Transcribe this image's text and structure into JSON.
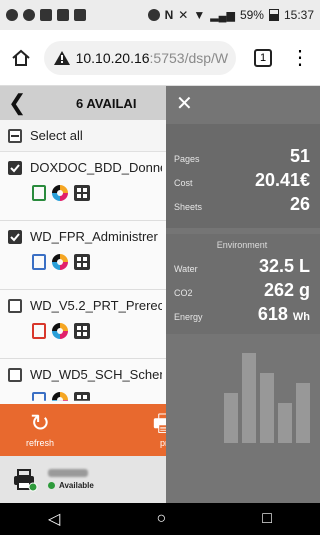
{
  "status": {
    "battery": "59%",
    "time": "15:37"
  },
  "browser": {
    "host": "10.10.20.16",
    "path": ":5753/dsp/W",
    "tab_count": "1"
  },
  "app": {
    "header_title": "6 AVAILAI",
    "select_all": "Select all",
    "documents": [
      {
        "name": "DOXDOC_BDD_Donne",
        "checked": true,
        "file_type": "xls"
      },
      {
        "name": "WD_FPR_Administrer",
        "checked": true,
        "file_type": "doc"
      },
      {
        "name": "WD_V5.2_PRT_Prerec",
        "checked": false,
        "file_type": "pdf"
      },
      {
        "name": "WD_WD5_SCH_Schen",
        "checked": false,
        "file_type": "doc"
      }
    ],
    "actions": [
      {
        "label": "refresh",
        "icon": "refresh-icon"
      },
      {
        "label": "pr",
        "icon": "print-icon"
      }
    ],
    "printer": {
      "status": "Available"
    }
  },
  "summary": {
    "pages_label": "Pages",
    "pages": "51",
    "cost_label": "Cost",
    "cost": "20.41€",
    "sheets_label": "Sheets",
    "sheets": "26",
    "environment_title": "Environment",
    "water_label": "Water",
    "water_value": "32.5",
    "water_unit": "L",
    "co2_label": "CO2",
    "co2_value": "262",
    "co2_unit": "g",
    "energy_label": "Energy",
    "energy_value": "618",
    "energy_unit": "Wh"
  },
  "colors": {
    "accent": "#e8692e",
    "overlay": "#757575",
    "available": "#2e9b3c"
  }
}
